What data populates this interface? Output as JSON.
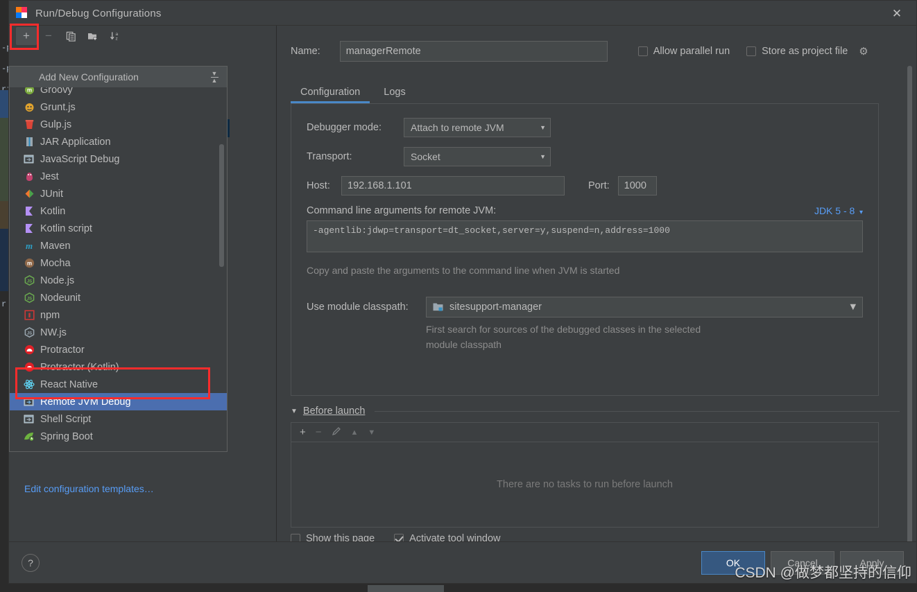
{
  "window": {
    "title": "Run/Debug Configurations",
    "app_icon": "intellij-idea-icon",
    "close_label": "✕"
  },
  "left_panel": {
    "toolbar": [
      {
        "name": "add-configuration-button",
        "glyph": "+",
        "state": "pressed"
      },
      {
        "name": "remove-configuration-button",
        "glyph": "−",
        "state": "disabled"
      },
      {
        "name": "copy-configuration-button",
        "glyph": "⎘",
        "state": "normal"
      },
      {
        "name": "new-folder-button",
        "glyph": "🗀",
        "state": "normal"
      },
      {
        "name": "sort-configurations-button",
        "glyph": "↓",
        "state": "normal"
      }
    ],
    "edit_templates_link": "Edit configuration templates…"
  },
  "popup": {
    "header": "Add New Configuration",
    "collapse_icon": "collapse-all-icon",
    "items": [
      {
        "label": "Groovy",
        "icon": "groovy-icon",
        "color": "#7aa93c",
        "glyph": "G",
        "shape": "circle",
        "selected": false,
        "clipped": true
      },
      {
        "label": "Grunt.js",
        "icon": "grunt-icon",
        "color": "#e0a32e",
        "glyph": "🐯",
        "shape": "glyph",
        "selected": false
      },
      {
        "label": "Gulp.js",
        "icon": "gulp-icon",
        "color": "#db4437",
        "glyph": "▼",
        "shape": "cup",
        "selected": false
      },
      {
        "label": "JAR Application",
        "icon": "jar-application-icon",
        "color": "#9aa7b0",
        "glyph": "☰",
        "shape": "jar",
        "selected": false
      },
      {
        "label": "JavaScript Debug",
        "icon": "javascript-debug-icon",
        "color": "#8a9aa5",
        "glyph": "JS",
        "shape": "window",
        "selected": false
      },
      {
        "label": "Jest",
        "icon": "jest-icon",
        "color": "#c2426e",
        "glyph": "J",
        "shape": "blob",
        "selected": false
      },
      {
        "label": "JUnit",
        "icon": "junit-icon",
        "color": "#f2762e",
        "glyph": "◀▶",
        "shape": "split",
        "selected": false
      },
      {
        "label": "Kotlin",
        "icon": "kotlin-icon",
        "color": "#b490f5",
        "glyph": "K",
        "shape": "flag",
        "selected": false
      },
      {
        "label": "Kotlin script",
        "icon": "kotlin-script-icon",
        "color": "#b490f5",
        "glyph": "K",
        "shape": "flag",
        "selected": false
      },
      {
        "label": "Maven",
        "icon": "maven-icon",
        "color": "#2e9ec4",
        "glyph": "m",
        "shape": "text",
        "selected": false
      },
      {
        "label": "Mocha",
        "icon": "mocha-icon",
        "color": "#8d6748",
        "glyph": "m",
        "shape": "circle",
        "selected": false
      },
      {
        "label": "Node.js",
        "icon": "nodejs-icon",
        "color": "#6aa84f",
        "glyph": "JS",
        "shape": "hex",
        "selected": false
      },
      {
        "label": "Nodeunit",
        "icon": "nodeunit-icon",
        "color": "#6aa84f",
        "glyph": "JS",
        "shape": "hex",
        "selected": false
      },
      {
        "label": "npm",
        "icon": "npm-icon",
        "color": "#cb3837",
        "glyph": "■",
        "shape": "square",
        "selected": false
      },
      {
        "label": "NW.js",
        "icon": "nwjs-icon",
        "color": "#9aa7b0",
        "glyph": "●",
        "shape": "hex",
        "selected": false
      },
      {
        "label": "Protractor",
        "icon": "protractor-icon",
        "color": "#e02128",
        "glyph": "◓",
        "shape": "circle",
        "selected": false
      },
      {
        "label": "Protractor (Kotlin)",
        "icon": "protractor-kotlin-icon",
        "color": "#e02128",
        "glyph": "◓",
        "shape": "circle",
        "selected": false
      },
      {
        "label": "React Native",
        "icon": "react-native-icon",
        "color": "#61dafb",
        "glyph": "⚛",
        "shape": "atom",
        "selected": false
      },
      {
        "label": "Remote JVM Debug",
        "icon": "remote-jvm-debug-icon",
        "color": "#6ea9d6",
        "glyph": "➡",
        "shape": "window",
        "selected": true
      },
      {
        "label": "Shell Script",
        "icon": "shell-script-icon",
        "color": "#9aa7b0",
        "glyph": "⌫",
        "shape": "window",
        "selected": false
      },
      {
        "label": "Spring Boot",
        "icon": "spring-boot-icon",
        "color": "#6db33f",
        "glyph": "◔",
        "shape": "leaf",
        "selected": false
      }
    ]
  },
  "config": {
    "name_label": "Name:",
    "name_value": "managerRemote",
    "allow_parallel_run_label": "Allow parallel run",
    "allow_parallel_run_checked": false,
    "store_as_project_file_label": "Store as project file",
    "store_as_project_file_checked": false,
    "store_gear_icon": "gear-icon",
    "tabs": [
      {
        "label": "Configuration",
        "active": true
      },
      {
        "label": "Logs",
        "active": false
      }
    ],
    "debugger_mode_label": "Debugger mode:",
    "debugger_mode_value": "Attach to remote JVM",
    "transport_label": "Transport:",
    "transport_value": "Socket",
    "host_label": "Host:",
    "host_value": "192.168.1.101",
    "port_label": "Port:",
    "port_value": "1000",
    "cmdline_label": "Command line arguments for remote JVM:",
    "jdk_selector": "JDK 5 - 8",
    "cmdline_value": "-agentlib:jdwp=transport=dt_socket,server=y,suspend=n,address=1000",
    "copy_hint": "Copy and paste the arguments to the command line when JVM is started",
    "module_classpath_label": "Use module classpath:",
    "module_classpath_value": "sitesupport-manager",
    "module_classpath_icon": "module-icon",
    "module_hint_line1": "First search for sources of the debugged classes in the selected",
    "module_hint_line2": "module classpath"
  },
  "before_launch": {
    "title": "Before launch",
    "caret_icon": "caret-down-icon",
    "toolbar": [
      {
        "name": "add-task-button",
        "glyph": "+",
        "state": "normal"
      },
      {
        "name": "remove-task-button",
        "glyph": "−",
        "state": "disabled"
      },
      {
        "name": "edit-task-button",
        "glyph": "╱",
        "state": "disabled"
      },
      {
        "name": "move-task-up-button",
        "glyph": "▲",
        "state": "disabled"
      },
      {
        "name": "move-task-down-button",
        "glyph": "▼",
        "state": "disabled"
      }
    ],
    "empty_text": "There are no tasks to run before launch",
    "show_page_label": "Show this page",
    "show_page_checked": false,
    "activate_tool_window_label": "Activate tool window",
    "activate_tool_window_checked": true
  },
  "footer": {
    "help_label": "?",
    "ok_label": "OK",
    "cancel_label": "Cancel",
    "apply_label": "Apply"
  },
  "watermark": "CSDN @做梦都坚持的信仰",
  "background": {
    "code_fragments": [
      "-p",
      "-p",
      "ri",
      "r.i"
    ]
  },
  "colors": {
    "accent_blue": "#4b6eaf",
    "link_blue": "#589df6",
    "primary_button": "#365880",
    "annotation_red": "#f92c2c",
    "panel_bg": "#3c3f41",
    "input_bg": "#45494a",
    "tree_selection": "#0d2a42"
  }
}
